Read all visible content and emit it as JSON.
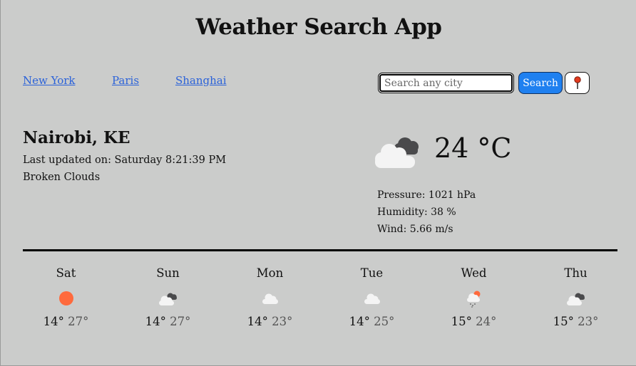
{
  "app": {
    "title": "Weather Search App"
  },
  "quick_cities": [
    {
      "label": "New York"
    },
    {
      "label": "Paris"
    },
    {
      "label": "Shanghai"
    }
  ],
  "search": {
    "placeholder": "Search any city",
    "value": "",
    "button_label": "Search",
    "location_icon": "pushpin-icon"
  },
  "current": {
    "city": "Nairobi, KE",
    "updated": "Last updated on: Saturday 8:21:39 PM",
    "condition": "Broken Clouds",
    "icon": "broken-clouds-icon",
    "temperature": "24 °C",
    "pressure": "Pressure: 1021 hPa",
    "humidity": "Humidity: 38 %",
    "wind": "Wind: 5.66 m/s"
  },
  "forecast": [
    {
      "day": "Sat",
      "icon": "sun-icon",
      "min": "14°",
      "max": "27°"
    },
    {
      "day": "Sun",
      "icon": "broken-clouds-icon",
      "min": "14°",
      "max": "27°"
    },
    {
      "day": "Mon",
      "icon": "cloud-icon",
      "min": "14°",
      "max": "23°"
    },
    {
      "day": "Tue",
      "icon": "cloud-icon",
      "min": "14°",
      "max": "25°"
    },
    {
      "day": "Wed",
      "icon": "rain-sun-icon",
      "min": "15°",
      "max": "24°"
    },
    {
      "day": "Thu",
      "icon": "broken-clouds-icon",
      "min": "15°",
      "max": "23°"
    }
  ],
  "colors": {
    "background": "#cbcccb",
    "link": "#2b62d9",
    "search_button": "#1f80f0",
    "sun": "#ff6a3d"
  }
}
